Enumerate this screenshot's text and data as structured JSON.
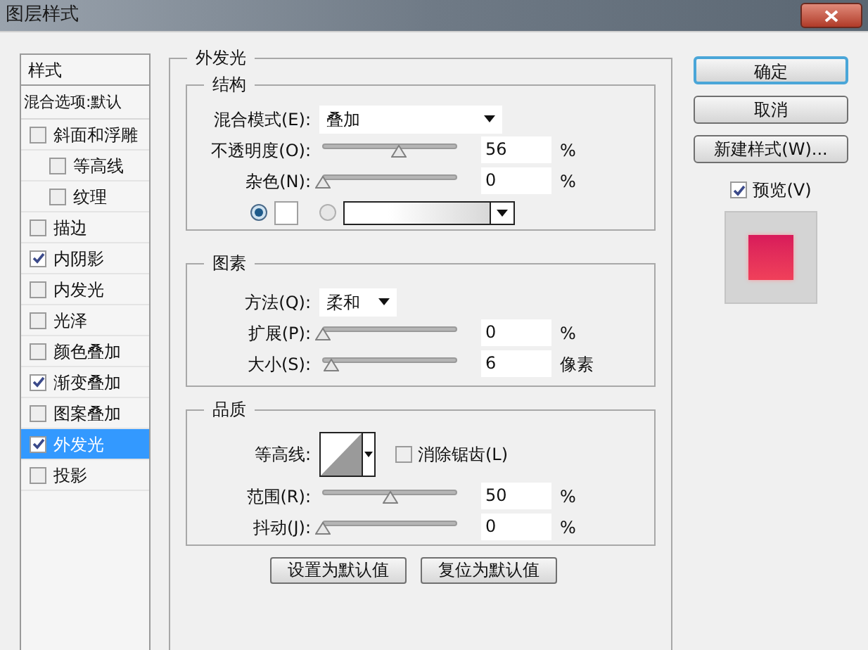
{
  "window": {
    "title": "图层样式"
  },
  "styles_panel": {
    "header": "样式",
    "blending_options": "混合选项:默认",
    "items": [
      {
        "label": "斜面和浮雕",
        "checked": false,
        "selected": false,
        "children": [
          {
            "label": "等高线",
            "checked": false,
            "selected": false
          },
          {
            "label": "纹理",
            "checked": false,
            "selected": false
          }
        ]
      },
      {
        "label": "描边",
        "checked": false,
        "selected": false
      },
      {
        "label": "内阴影",
        "checked": true,
        "selected": false
      },
      {
        "label": "内发光",
        "checked": false,
        "selected": false
      },
      {
        "label": "光泽",
        "checked": false,
        "selected": false
      },
      {
        "label": "颜色叠加",
        "checked": false,
        "selected": false
      },
      {
        "label": "渐变叠加",
        "checked": true,
        "selected": false
      },
      {
        "label": "图案叠加",
        "checked": false,
        "selected": false
      },
      {
        "label": "外发光",
        "checked": true,
        "selected": true
      },
      {
        "label": "投影",
        "checked": false,
        "selected": false
      }
    ]
  },
  "outer_glow": {
    "title": "外发光",
    "structure": {
      "title": "结构",
      "blend_mode": {
        "label": "混合模式(E):",
        "value": "叠加"
      },
      "opacity": {
        "label": "不透明度(O):",
        "level": 0.56,
        "value": "56",
        "unit": "%"
      },
      "noise": {
        "label": "杂色(N):",
        "level": 0,
        "value": "0",
        "unit": "%"
      },
      "color_modes": [
        {
          "kind": "swatch",
          "selected": true
        },
        {
          "kind": "gradient",
          "selected": false
        }
      ]
    },
    "elements": {
      "title": "图素",
      "technique": {
        "label": "方法(Q):",
        "value": "柔和"
      },
      "spread": {
        "label": "扩展(P):",
        "level": 0,
        "value": "0",
        "unit": "%"
      },
      "size": {
        "label": "大小(S):",
        "level": 0.06,
        "value": "6",
        "unit": "像素"
      }
    },
    "quality": {
      "title": "品质",
      "contour": {
        "label": "等高线:"
      },
      "anti_alias": {
        "label": "消除锯齿(L)",
        "checked": false
      },
      "range": {
        "label": "范围(R):",
        "level": 0.5,
        "value": "50",
        "unit": "%"
      },
      "jitter": {
        "label": "抖动(J):",
        "level": 0,
        "value": "0",
        "unit": "%"
      }
    },
    "buttons": [
      "设置为默认值",
      "复位为默认值"
    ]
  },
  "actions": [
    {
      "label": "确定",
      "default": true
    },
    {
      "label": "取消",
      "default": false
    },
    {
      "label": "新建样式(W)...",
      "default": false
    }
  ],
  "preview": {
    "label": "预览(V)",
    "checked": true
  }
}
